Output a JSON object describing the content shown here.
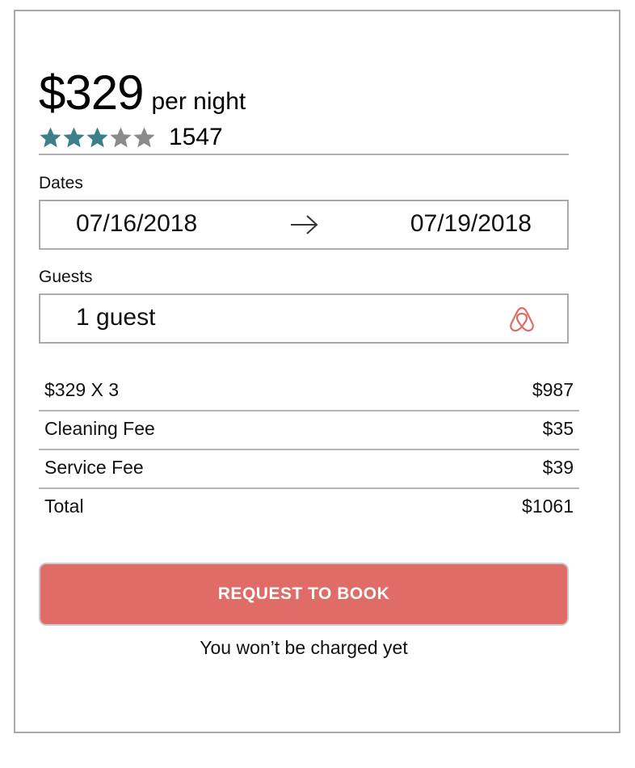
{
  "listing": {
    "price": "$329",
    "price_unit": "per night",
    "rating": {
      "value": 3,
      "max": 5,
      "filled_color": "#3b7f88",
      "empty_color": "#8a8a8a"
    },
    "review_count": "1547"
  },
  "dates": {
    "label": "Dates",
    "check_in": "07/16/2018",
    "check_out": "07/19/2018",
    "separator_icon": "arrow-right-icon"
  },
  "guests": {
    "label": "Guests",
    "value": "1 guest",
    "icon": "airbnb-logo-icon",
    "icon_color": "#e06c67"
  },
  "breakdown": [
    {
      "label": "$329 X 3",
      "amount": "$987"
    },
    {
      "label": "Cleaning Fee",
      "amount": "$35"
    },
    {
      "label": "Service Fee",
      "amount": "$39"
    },
    {
      "label": "Total",
      "amount": "$1061"
    }
  ],
  "cta": {
    "label": "REQUEST TO BOOK",
    "color": "#e06c67"
  },
  "footnote": "You won’t be charged yet"
}
